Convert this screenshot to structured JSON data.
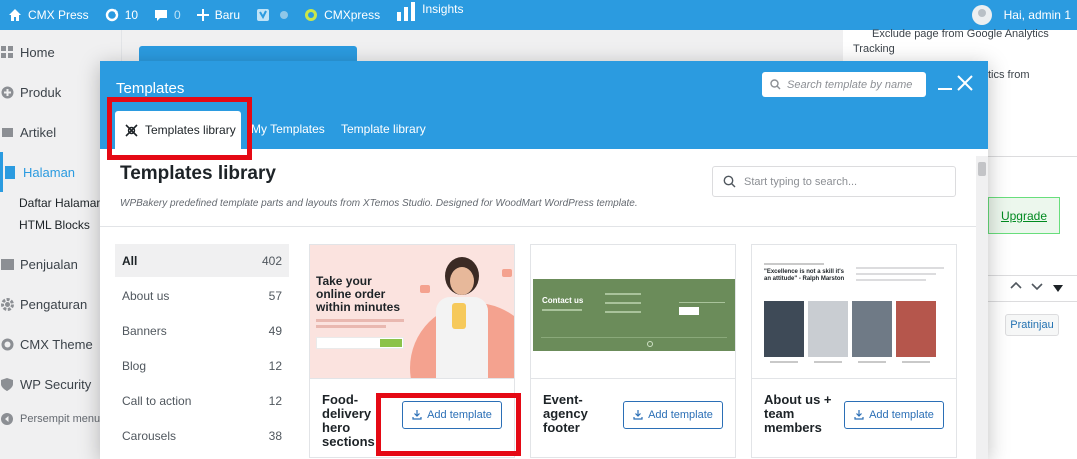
{
  "admin_bar": {
    "site": "CMX Press",
    "updates": "10",
    "comments": "0",
    "new_label": "Baru",
    "cmxpress": "CMXpress",
    "insights": "Insights",
    "greeting": "Hai, admin 1"
  },
  "sidebar": {
    "items": [
      {
        "label": "Home",
        "icon": "dashboard-icon"
      },
      {
        "label": "Produk",
        "icon": "plus-circle-icon"
      },
      {
        "label": "Artikel",
        "icon": "post-icon"
      },
      {
        "label": "Halaman",
        "icon": "page-icon"
      },
      {
        "label": "Penjualan",
        "icon": "chart-icon"
      },
      {
        "label": "Pengaturan",
        "icon": "gear-icon"
      },
      {
        "label": "CMX Theme",
        "icon": "cmx-icon"
      },
      {
        "label": "WP Security",
        "icon": "shield-icon"
      }
    ],
    "subitems": [
      "Daftar Halaman",
      "HTML Blocks"
    ],
    "collapse": "Persempit menu"
  },
  "right_panel": {
    "exclude_line1": "Exclude page from Google Analytics",
    "exclude_line2": "Tracking",
    "analytics_frag": "tics from",
    "upgrade": "Upgrade",
    "preview": "Pratinjau"
  },
  "modal": {
    "title": "Templates",
    "search_placeholder": "Search template by name",
    "tabs": [
      "Templates library",
      "My Templates",
      "Template library"
    ],
    "library_title": "Templates library",
    "library_desc": "WPBakery predefined template parts and layouts from XTemos Studio. Designed for WoodMart WordPress template.",
    "library_search_placeholder": "Start typing to search...",
    "categories": [
      {
        "name": "All",
        "count": "402"
      },
      {
        "name": "About us",
        "count": "57"
      },
      {
        "name": "Banners",
        "count": "49"
      },
      {
        "name": "Blog",
        "count": "12"
      },
      {
        "name": "Call to action",
        "count": "12"
      },
      {
        "name": "Carousels",
        "count": "38"
      }
    ],
    "cards": [
      {
        "title": "Food-delivery hero sections",
        "button": "Add template",
        "thumb": {
          "headline": "Take your online order within minutes"
        }
      },
      {
        "title": "Event-agency footer",
        "button": "Add template",
        "thumb": {
          "contact": "Contact us"
        }
      },
      {
        "title": "About us + team members",
        "button": "Add template",
        "thumb": {
          "quote": "\"Excellence is not a skill it's an attitude\" - Ralph Marston"
        }
      }
    ]
  },
  "colors": {
    "primary": "#2b9be0",
    "highlight": "#e50914",
    "button_text": "#2b6fb6",
    "footer_green": "#6b8c5a",
    "food_pink": "#fbe3df"
  }
}
